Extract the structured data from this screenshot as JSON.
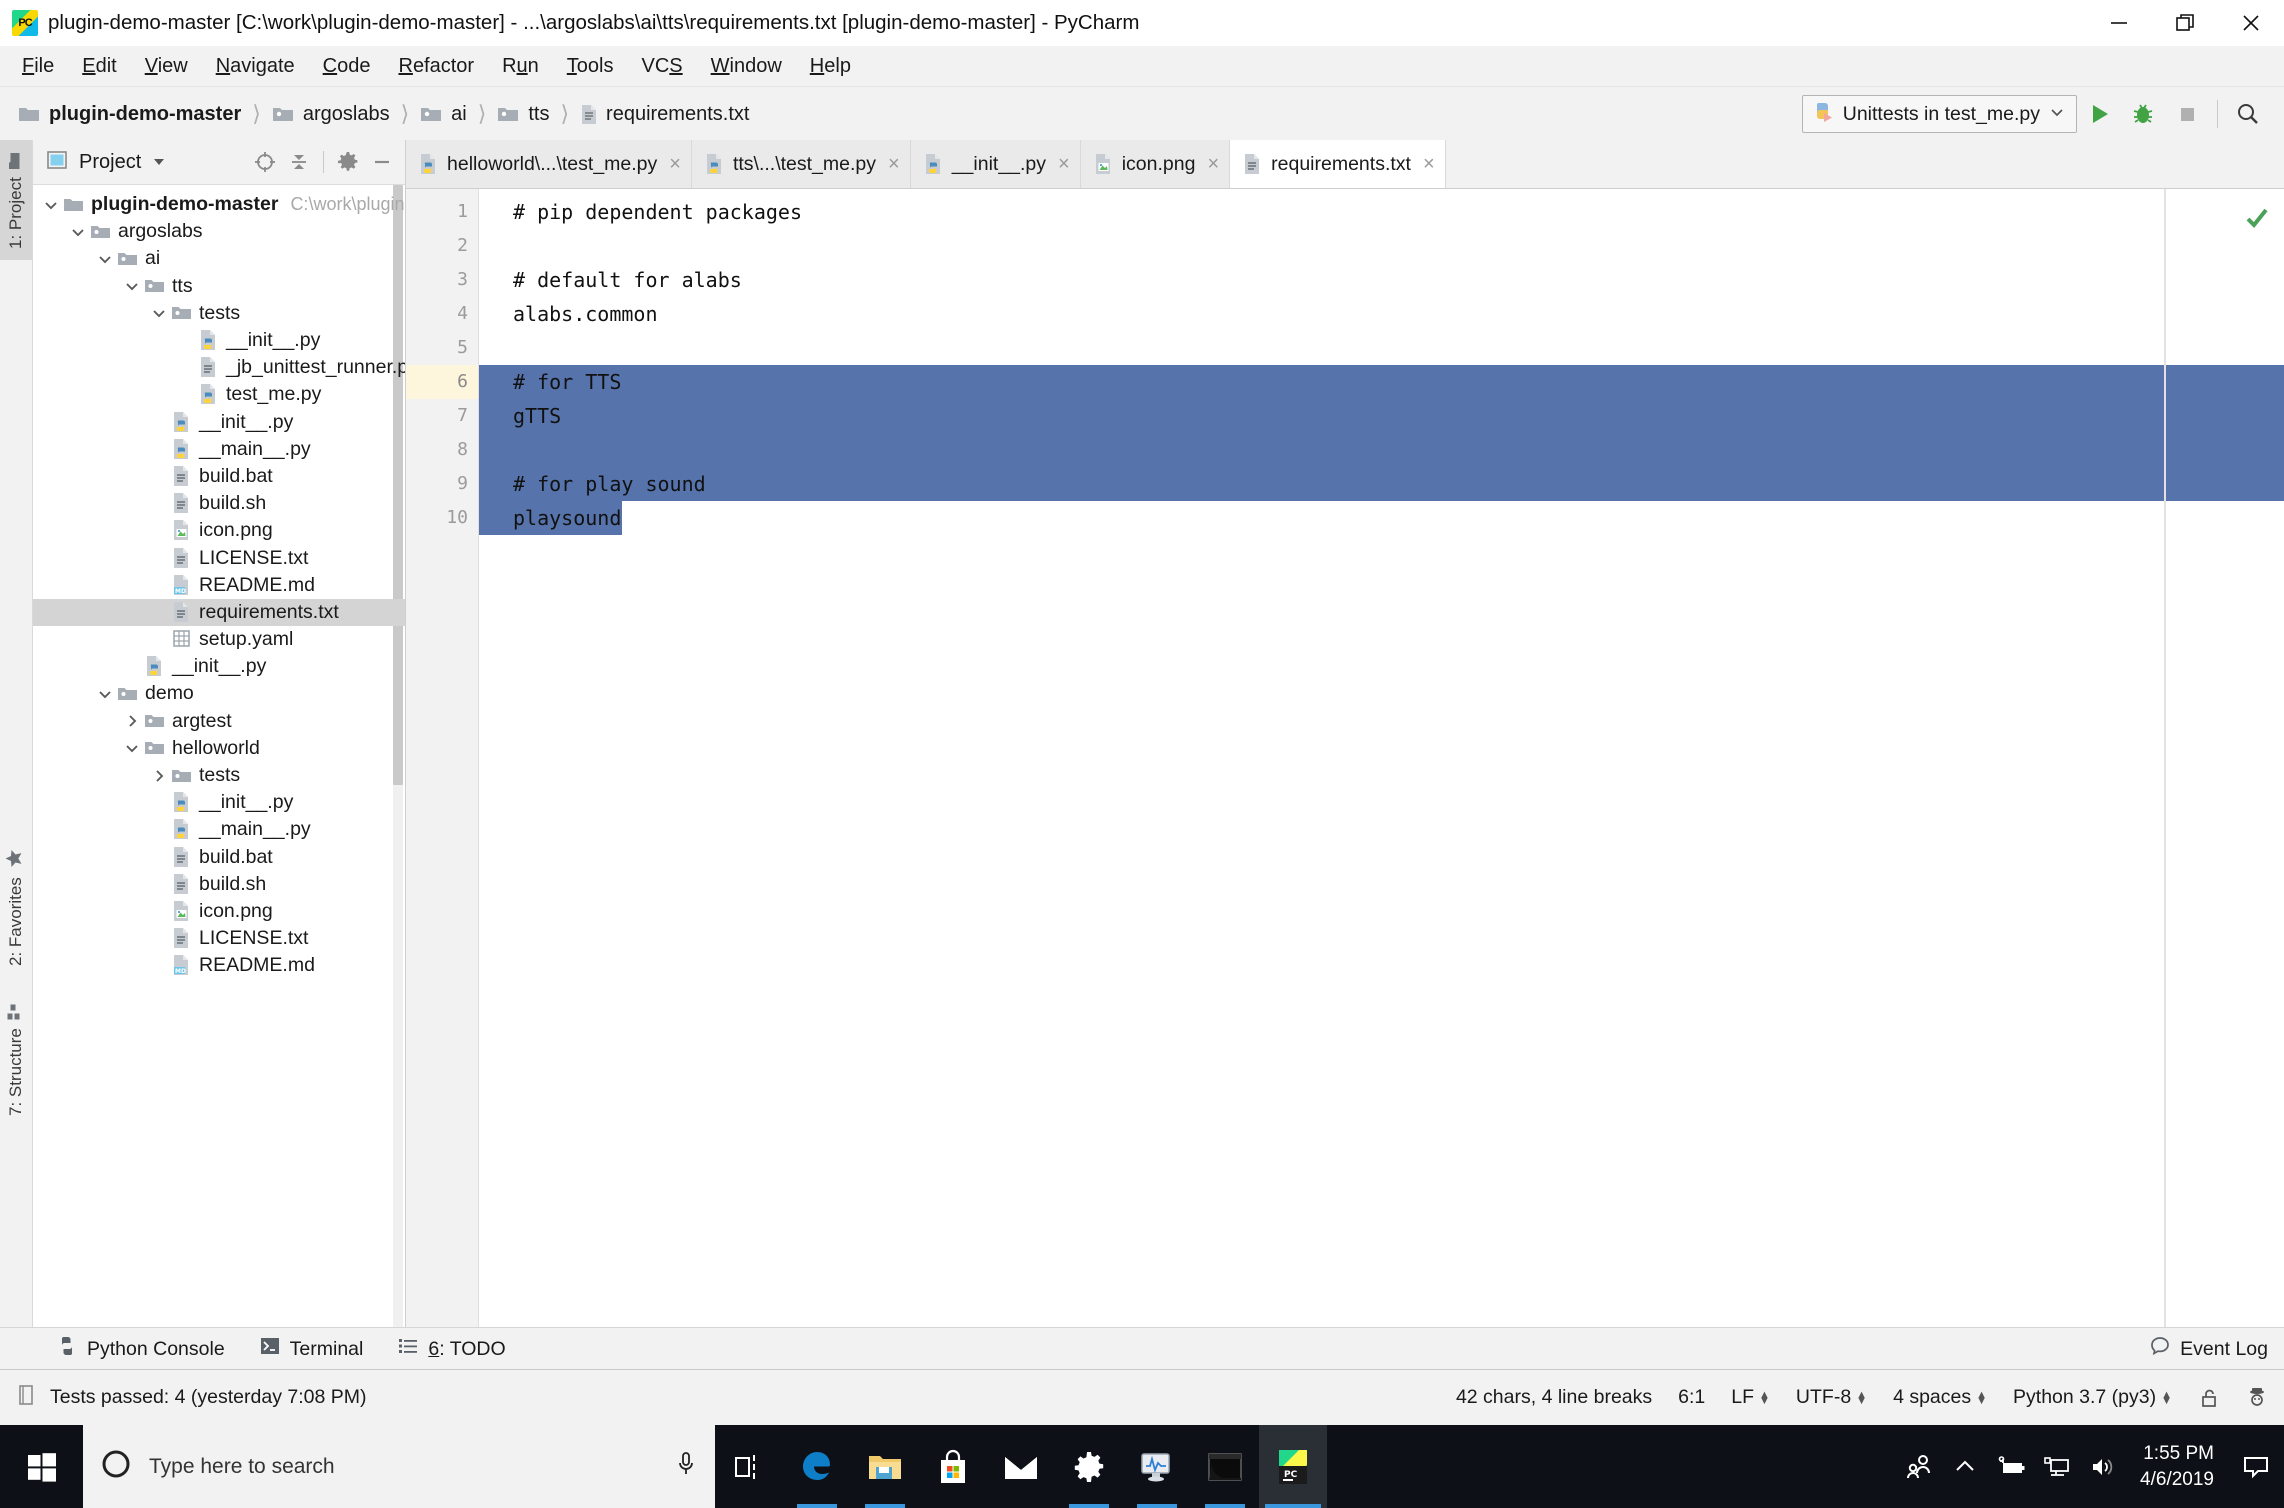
{
  "window": {
    "title": "plugin-demo-master [C:\\work\\plugin-demo-master] - ...\\argoslabs\\ai\\tts\\requirements.txt [plugin-demo-master] - PyCharm",
    "app_icon_label": "PC",
    "controls": {
      "minimize": "minimize-icon",
      "restore": "restore-icon",
      "close": "close-icon"
    }
  },
  "menu": [
    {
      "label": "File",
      "accel": "F"
    },
    {
      "label": "Edit",
      "accel": "E"
    },
    {
      "label": "View",
      "accel": "V"
    },
    {
      "label": "Navigate",
      "accel": "N"
    },
    {
      "label": "Code",
      "accel": "C"
    },
    {
      "label": "Refactor",
      "accel": "R"
    },
    {
      "label": "Run",
      "accel": "u"
    },
    {
      "label": "Tools",
      "accel": "T"
    },
    {
      "label": "VCS",
      "accel": "S"
    },
    {
      "label": "Window",
      "accel": "W"
    },
    {
      "label": "Help",
      "accel": "H"
    }
  ],
  "breadcrumb": [
    {
      "label": "plugin-demo-master",
      "icon": "folder-icon",
      "bold": true
    },
    {
      "label": "argoslabs",
      "icon": "package-folder-icon",
      "bold": false
    },
    {
      "label": "ai",
      "icon": "package-folder-icon",
      "bold": false
    },
    {
      "label": "tts",
      "icon": "package-folder-icon",
      "bold": false
    },
    {
      "label": "requirements.txt",
      "icon": "text-file-icon",
      "bold": false
    }
  ],
  "toolbar": {
    "run_config": "Unittests in test_me.py",
    "run_config_icon": "python-test-icon",
    "dropdown_icon": "chevron-down-icon",
    "run_button": "run-icon",
    "debug_button": "debug-icon",
    "stop_button": "stop-icon",
    "search_button": "search-icon"
  },
  "left_stripe": [
    {
      "label": "1: Project",
      "icon": "project-folder-icon",
      "active": true
    },
    {
      "label": "2: Favorites",
      "icon": "star-icon",
      "active": false
    },
    {
      "label": "7: Structure",
      "icon": "structure-icon",
      "active": false
    }
  ],
  "project_panel": {
    "title": "Project",
    "caret": "chevron-down-icon",
    "actions": [
      "locate-icon",
      "collapse-all-icon",
      "gear-icon",
      "hide-icon"
    ],
    "tree": [
      {
        "depth": 0,
        "label": "plugin-demo-master",
        "sub": "C:\\work\\plugin-dem",
        "icon": "folder-icon",
        "twisty": "expanded",
        "bold": true,
        "selected": false
      },
      {
        "depth": 1,
        "label": "argoslabs",
        "icon": "package-folder-icon",
        "twisty": "expanded",
        "bold": false,
        "selected": false
      },
      {
        "depth": 2,
        "label": "ai",
        "icon": "package-folder-icon",
        "twisty": "expanded",
        "bold": false,
        "selected": false
      },
      {
        "depth": 3,
        "label": "tts",
        "icon": "package-folder-icon",
        "twisty": "expanded",
        "bold": false,
        "selected": false
      },
      {
        "depth": 4,
        "label": "tests",
        "icon": "package-folder-icon",
        "twisty": "expanded",
        "bold": false,
        "selected": false
      },
      {
        "depth": 5,
        "label": "__init__.py",
        "icon": "python-file-icon",
        "twisty": "none",
        "bold": false,
        "selected": false
      },
      {
        "depth": 5,
        "label": "_jb_unittest_runner.py.log",
        "icon": "text-file-icon",
        "twisty": "none",
        "bold": false,
        "selected": false
      },
      {
        "depth": 5,
        "label": "test_me.py",
        "icon": "python-file-icon",
        "twisty": "none",
        "bold": false,
        "selected": false
      },
      {
        "depth": 4,
        "label": "__init__.py",
        "icon": "python-file-icon",
        "twisty": "none",
        "bold": false,
        "selected": false
      },
      {
        "depth": 4,
        "label": "__main__.py",
        "icon": "python-file-icon",
        "twisty": "none",
        "bold": false,
        "selected": false
      },
      {
        "depth": 4,
        "label": "build.bat",
        "icon": "text-file-icon",
        "twisty": "none",
        "bold": false,
        "selected": false
      },
      {
        "depth": 4,
        "label": "build.sh",
        "icon": "text-file-icon",
        "twisty": "none",
        "bold": false,
        "selected": false
      },
      {
        "depth": 4,
        "label": "icon.png",
        "icon": "image-file-icon",
        "twisty": "none",
        "bold": false,
        "selected": false
      },
      {
        "depth": 4,
        "label": "LICENSE.txt",
        "icon": "text-file-icon",
        "twisty": "none",
        "bold": false,
        "selected": false
      },
      {
        "depth": 4,
        "label": "README.md",
        "icon": "markdown-file-icon",
        "twisty": "none",
        "bold": false,
        "selected": false
      },
      {
        "depth": 4,
        "label": "requirements.txt",
        "icon": "text-file-icon",
        "twisty": "none",
        "bold": false,
        "selected": true
      },
      {
        "depth": 4,
        "label": "setup.yaml",
        "icon": "yaml-file-icon",
        "twisty": "none",
        "bold": false,
        "selected": false
      },
      {
        "depth": 3,
        "label": "__init__.py",
        "icon": "python-file-icon",
        "twisty": "none",
        "bold": false,
        "selected": false
      },
      {
        "depth": 2,
        "label": "demo",
        "icon": "package-folder-icon",
        "twisty": "expanded",
        "bold": false,
        "selected": false
      },
      {
        "depth": 3,
        "label": "argtest",
        "icon": "package-folder-icon",
        "twisty": "collapsed",
        "bold": false,
        "selected": false
      },
      {
        "depth": 3,
        "label": "helloworld",
        "icon": "package-folder-icon",
        "twisty": "expanded",
        "bold": false,
        "selected": false
      },
      {
        "depth": 4,
        "label": "tests",
        "icon": "package-folder-icon",
        "twisty": "collapsed",
        "bold": false,
        "selected": false
      },
      {
        "depth": 4,
        "label": "__init__.py",
        "icon": "python-file-icon",
        "twisty": "none",
        "bold": false,
        "selected": false
      },
      {
        "depth": 4,
        "label": "__main__.py",
        "icon": "python-file-icon",
        "twisty": "none",
        "bold": false,
        "selected": false
      },
      {
        "depth": 4,
        "label": "build.bat",
        "icon": "text-file-icon",
        "twisty": "none",
        "bold": false,
        "selected": false
      },
      {
        "depth": 4,
        "label": "build.sh",
        "icon": "text-file-icon",
        "twisty": "none",
        "bold": false,
        "selected": false
      },
      {
        "depth": 4,
        "label": "icon.png",
        "icon": "image-file-icon",
        "twisty": "none",
        "bold": false,
        "selected": false
      },
      {
        "depth": 4,
        "label": "LICENSE.txt",
        "icon": "text-file-icon",
        "twisty": "none",
        "bold": false,
        "selected": false
      },
      {
        "depth": 4,
        "label": "README.md",
        "icon": "markdown-file-icon",
        "twisty": "none",
        "bold": false,
        "selected": false
      }
    ]
  },
  "editor": {
    "tabs": [
      {
        "label": "helloworld\\...\\test_me.py",
        "icon": "python-file-icon",
        "active": false,
        "close": "×"
      },
      {
        "label": "tts\\...\\test_me.py",
        "icon": "python-file-icon",
        "active": false,
        "close": "×"
      },
      {
        "label": "__init__.py",
        "icon": "python-file-icon",
        "active": false,
        "close": "×"
      },
      {
        "label": "icon.png",
        "icon": "image-file-icon",
        "active": false,
        "close": "×"
      },
      {
        "label": "requirements.txt",
        "icon": "text-file-icon",
        "active": true,
        "close": "×"
      }
    ],
    "lines": [
      {
        "n": "1",
        "text": "# pip dependent packages",
        "selected": false
      },
      {
        "n": "2",
        "text": "",
        "selected": false
      },
      {
        "n": "3",
        "text": "# default for alabs",
        "selected": false
      },
      {
        "n": "4",
        "text": "alabs.common",
        "selected": false
      },
      {
        "n": "5",
        "text": "",
        "selected": false
      },
      {
        "n": "6",
        "text": "# for TTS",
        "selected": true
      },
      {
        "n": "7",
        "text": "gTTS",
        "selected": true
      },
      {
        "n": "8",
        "text": "",
        "selected": true
      },
      {
        "n": "9",
        "text": "# for play sound",
        "selected": true
      },
      {
        "n": "10",
        "text": "playsound",
        "selected": true
      }
    ],
    "caret_line": 6,
    "selection_color": "#5673ab",
    "caret_line_color": "#fdf6dd",
    "inspection_status": "ok-check-icon"
  },
  "bottom_tools": [
    {
      "label": "Python Console",
      "icon": "python-console-icon"
    },
    {
      "label": "Terminal",
      "icon": "terminal-icon"
    },
    {
      "label": "6: TODO",
      "icon": "todo-list-icon",
      "accel": "6"
    }
  ],
  "bottom_right": {
    "label": "Event Log",
    "icon": "event-log-icon"
  },
  "status_bar": {
    "message": "Tests passed: 4 (yesterday 7:08 PM)",
    "message_icon": "document-icon",
    "chars": "42 chars, 4 line breaks",
    "caret_pos": "6:1",
    "line_sep": "LF",
    "encoding": "UTF-8",
    "indent": "4 spaces",
    "interpreter": "Python 3.7 (py3)",
    "lock_icon": "unlocked-icon",
    "hector_icon": "hector-inspection-icon"
  },
  "taskbar": {
    "start": "windows-start-icon",
    "search_placeholder": "Type here to search",
    "search_circle": "cortana-icon",
    "mic": "microphone-icon",
    "items": [
      {
        "name": "task-view-icon",
        "state": "idle"
      },
      {
        "name": "edge-icon",
        "state": "open"
      },
      {
        "name": "file-explorer-icon",
        "state": "open"
      },
      {
        "name": "microsoft-store-icon",
        "state": "idle"
      },
      {
        "name": "mail-icon",
        "state": "idle"
      },
      {
        "name": "settings-icon",
        "state": "open"
      },
      {
        "name": "resource-monitor-icon",
        "state": "open"
      },
      {
        "name": "command-prompt-icon",
        "state": "open"
      },
      {
        "name": "pycharm-icon",
        "state": "focused"
      }
    ],
    "tray": [
      {
        "name": "people-icon"
      },
      {
        "name": "show-hidden-icons-icon"
      },
      {
        "name": "battery-icon"
      },
      {
        "name": "network-icon"
      },
      {
        "name": "volume-icon"
      }
    ],
    "time": "1:55 PM",
    "date": "4/6/2019",
    "notifications": "notification-center-icon"
  }
}
